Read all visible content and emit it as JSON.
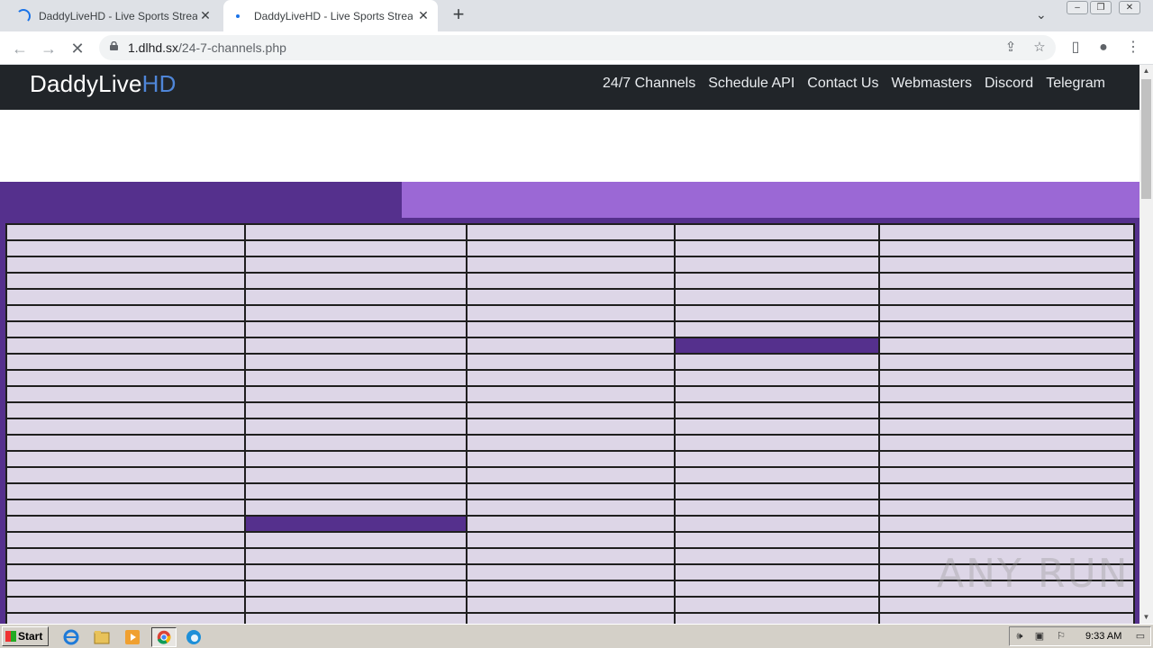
{
  "browser": {
    "tabs": [
      {
        "title": "DaddyLiveHD - Live Sports Streaming",
        "loading": true
      },
      {
        "title": "DaddyLiveHD - Live Sports Streaming",
        "loading": true,
        "active": true
      }
    ],
    "url_host": "1.dlhd.sx",
    "url_path": "/24-7-channels.php"
  },
  "site": {
    "brand_main": "DaddyLive",
    "brand_accent": "HD",
    "nav": [
      "24/7 Channels",
      "Schedule API",
      "Contact Us",
      "Webmasters",
      "Discord",
      "Telegram"
    ]
  },
  "colors": {
    "navbar": "#212529",
    "banner_dark": "#55308d",
    "banner_light": "#9b68d5",
    "cell": "#ddd6e7",
    "brand_accent": "#4f86d8"
  },
  "grid": {
    "rows": 25,
    "cols": 5,
    "highlighted": [
      [
        7,
        3
      ],
      [
        18,
        1
      ]
    ]
  },
  "taskbar": {
    "start_label": "Start",
    "clock": "9:33 AM"
  },
  "watermark": "ANY RUN"
}
